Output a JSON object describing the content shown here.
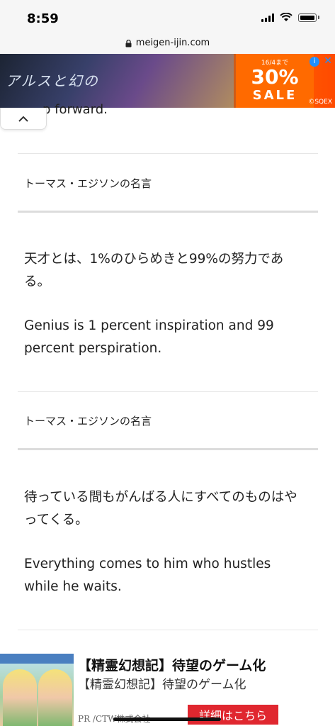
{
  "status_bar": {
    "time": "8:59"
  },
  "browser": {
    "url": "meigen-ijin.com"
  },
  "top_ad": {
    "logo_text": "アルスと幻の",
    "sale_small": "16/4まで",
    "sale_percent": "30%",
    "sale_word": "SALE",
    "brand": "©SQEX",
    "info_label": "i",
    "close_label": "✕"
  },
  "content": {
    "cut_text": "p forward.",
    "entries": [
      {
        "author": "トーマス・エジソンの名言"
      },
      {
        "quote_jp": "天才とは、1%のひらめきと99%の努力である。",
        "quote_en": "Genius is 1 percent inspiration and 99 percent perspiration.",
        "author": "トーマス・エジソンの名言"
      },
      {
        "quote_jp": "待っている間もがんばる人にすべてのものはやってくる。",
        "quote_en": "Everything comes to him who hustles while he waits."
      }
    ]
  },
  "bottom_ad": {
    "title_bold": "【精霊幻想記】待望のゲーム化",
    "title": "【精霊幻想記】待望のゲーム化",
    "pr": "PR /CTW株式会社",
    "cta": "詳細はこちら"
  }
}
